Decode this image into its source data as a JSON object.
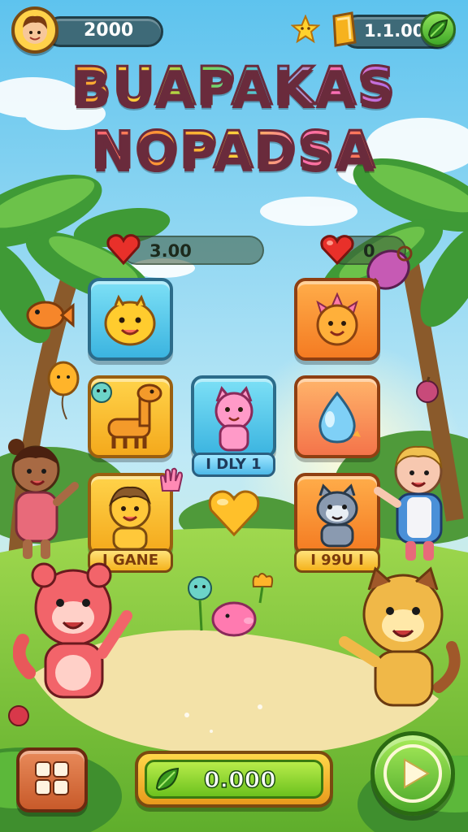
{
  "hud": {
    "coins": "2000",
    "gems": "1.1.00",
    "title_line1": "BUAPAKAS",
    "title_line2": "NOPADSA",
    "lives_left": "3.00",
    "lives_right": "0"
  },
  "grid": {
    "center_card_label": "I DLY 1",
    "left_card_label": "I GANE",
    "right_card_label": "I 99U I"
  },
  "footer": {
    "score": "0.000"
  },
  "icons": [
    "avatar-icon",
    "star-icon",
    "gem-icon",
    "leaf-icon",
    "heart-icon",
    "menu-grid-icon",
    "play-icon"
  ]
}
